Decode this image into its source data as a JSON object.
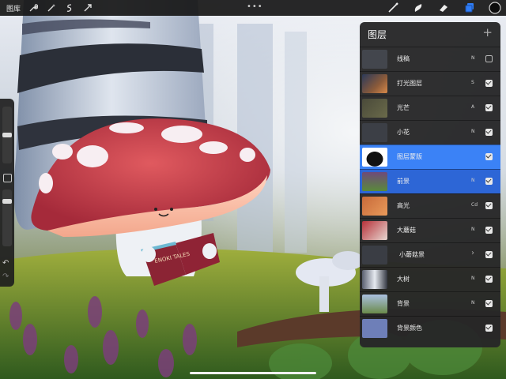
{
  "topbar": {
    "gallery_label": "图库",
    "more_icon": "•••",
    "left_tools": [
      "wrench-icon",
      "magic-wand-icon",
      "selection-icon",
      "transform-arrow-icon"
    ],
    "right_tools": [
      "brush-icon",
      "smudge-icon",
      "eraser-icon",
      "layers-icon",
      "color-picker-icon"
    ],
    "active_color": "#0d0d0d",
    "accent": "#2f7df6"
  },
  "sidebar": {
    "brush_size_level": 0.5,
    "opacity_level": 0.12,
    "undo_icon": "↶",
    "redo_icon": "↷"
  },
  "layers": {
    "title": "图层",
    "add_icon": "+",
    "items": [
      {
        "name": "线稿",
        "mode": "N",
        "visible": false,
        "type": "normal"
      },
      {
        "name": "打光图层",
        "mode": "S",
        "visible": true,
        "type": "normal"
      },
      {
        "name": "光芒",
        "mode": "A",
        "visible": true,
        "type": "normal"
      },
      {
        "name": "小花",
        "mode": "N",
        "visible": true,
        "type": "normal"
      },
      {
        "name": "图层蒙版",
        "mode": "",
        "visible": true,
        "type": "mask"
      },
      {
        "name": "前景",
        "mode": "N",
        "visible": true,
        "type": "selected"
      },
      {
        "name": "高光",
        "mode": "Cd",
        "visible": true,
        "type": "normal"
      },
      {
        "name": "大蘑菇",
        "mode": "N",
        "visible": true,
        "type": "normal"
      },
      {
        "name": "小蘑菇景",
        "mode": "",
        "visible": true,
        "type": "group"
      },
      {
        "name": "大树",
        "mode": "N",
        "visible": true,
        "type": "normal"
      },
      {
        "name": "背景",
        "mode": "N",
        "visible": true,
        "type": "normal"
      },
      {
        "name": "背景颜色",
        "mode": "",
        "visible": true,
        "type": "color"
      }
    ]
  },
  "artwork": {
    "book_title": "ENOKI TALES"
  }
}
